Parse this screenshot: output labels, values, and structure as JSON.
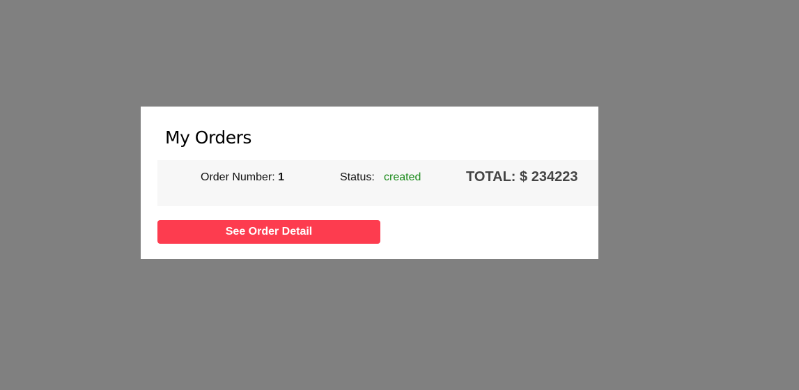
{
  "modal": {
    "title": "My Orders"
  },
  "order": {
    "number_label": "Order Number:",
    "number_value": "1",
    "status_label": "Status:",
    "status_value": "created",
    "total_text": "TOTAL: $ 234223"
  },
  "actions": {
    "see_detail_label": "See Order Detail"
  },
  "colors": {
    "backdrop": "#808080",
    "accent_button": "#fd3c4f",
    "status_created": "#1a8a1a",
    "row_background": "#f7f7f7"
  }
}
